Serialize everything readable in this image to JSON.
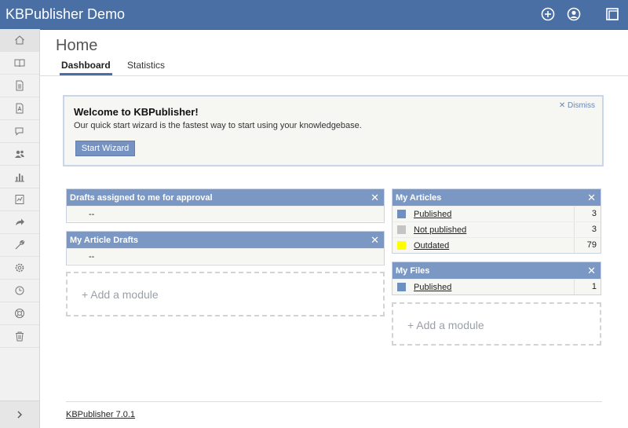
{
  "app": {
    "title": "KBPublisher Demo"
  },
  "topbar": {
    "icons": [
      "add-circle-icon",
      "user-profile-icon",
      "window-icon"
    ]
  },
  "sidebar": {
    "items": [
      "home-icon",
      "book-icon",
      "document-icon",
      "file-pdf-icon",
      "chat-icon",
      "users-icon",
      "bar-chart-icon",
      "report-icon",
      "share-arrow-icon",
      "wrench-icon",
      "gear-icon",
      "history-icon",
      "lifebuoy-icon",
      "trash-icon"
    ],
    "expand_icon": "chevron-right-icon"
  },
  "page": {
    "title": "Home"
  },
  "tabs": [
    {
      "label": "Dashboard"
    },
    {
      "label": "Statistics"
    }
  ],
  "welcome": {
    "title": "Welcome to KBPublisher!",
    "text": "Our quick start wizard is the fastest way to start using your knowledgebase.",
    "button": "Start Wizard",
    "dismiss": "Dismiss"
  },
  "modules": {
    "drafts_approval": {
      "title": "Drafts assigned to me for approval",
      "value": "--"
    },
    "article_drafts": {
      "title": "My Article Drafts",
      "value": "--"
    },
    "my_articles": {
      "title": "My Articles",
      "rows": [
        {
          "label": "Published",
          "count": "3",
          "color": "#6e8fc0"
        },
        {
          "label": "Not published",
          "count": "3",
          "color": "#c4c4c4"
        },
        {
          "label": "Outdated",
          "count": "79",
          "color": "#ffff00"
        }
      ]
    },
    "my_files": {
      "title": "My Files",
      "rows": [
        {
          "label": "Published",
          "count": "1",
          "color": "#6e8fc0"
        }
      ]
    },
    "close_symbol": "✕",
    "add_module_left": "+ Add a module",
    "add_module_right": "+ Add a module"
  },
  "footer": {
    "version": "KBPublisher 7.0.1"
  },
  "colors": {
    "brand": "#4a6fa5",
    "module_header": "#7b97c4"
  }
}
